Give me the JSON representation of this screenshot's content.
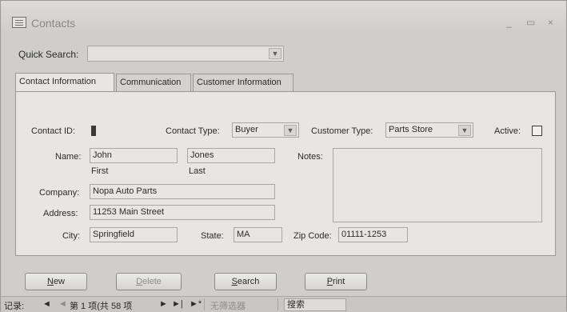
{
  "window": {
    "title": "Contacts",
    "minimize": "_",
    "maximize": "▭",
    "close": "×"
  },
  "quick_search": {
    "label": "Quick Search:",
    "value": ""
  },
  "tabs": [
    {
      "label": "Contact Information",
      "active": true
    },
    {
      "label": "Communication",
      "active": false
    },
    {
      "label": "Customer Information",
      "active": false
    }
  ],
  "form": {
    "contact_id": {
      "label": "Contact ID:",
      "value": ""
    },
    "contact_type": {
      "label": "Contact Type:",
      "value": "Buyer"
    },
    "customer_type": {
      "label": "Customer Type:",
      "value": "Parts Store"
    },
    "active": {
      "label": "Active:",
      "checked": false
    },
    "name": {
      "label": "Name:",
      "first": "John",
      "last": "Jones",
      "first_sub": "First",
      "last_sub": "Last"
    },
    "notes": {
      "label": "Notes:",
      "value": ""
    },
    "company": {
      "label": "Company:",
      "value": "Nopa Auto Parts"
    },
    "address": {
      "label": "Address:",
      "value": "11253 Main Street"
    },
    "city": {
      "label": "City:",
      "value": "Springfield"
    },
    "state": {
      "label": "State:",
      "value": "MA"
    },
    "zip": {
      "label": "Zip Code:",
      "value": "01111-1253"
    }
  },
  "buttons": {
    "new": {
      "accel": "N",
      "rest": "ew"
    },
    "delete": {
      "accel": "D",
      "rest": "elete"
    },
    "search": {
      "accel": "S",
      "rest": "earch"
    },
    "print": {
      "accel": "P",
      "rest": "rint"
    }
  },
  "navigation": {
    "label": "记录:",
    "first": "◄",
    "prev": "◄",
    "record_text": "第 1 项(共 58 项",
    "next": "►",
    "last": "►|",
    "new_record": "►*",
    "filter_text": "无筛选器",
    "search_text": "搜索"
  },
  "colors": {
    "window_bg": "#cfcecb",
    "panel_bg": "#e7e6e3",
    "border": "#9a9995"
  }
}
